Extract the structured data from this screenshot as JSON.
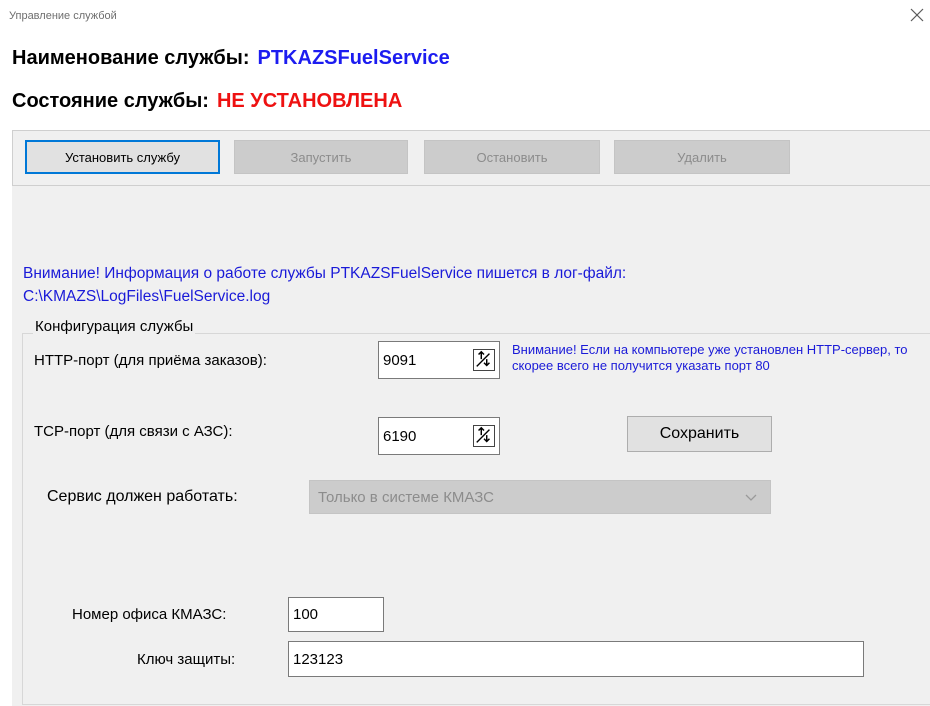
{
  "window": {
    "title": "Управление службой",
    "close_icon": "close-icon"
  },
  "header": {
    "name_label": "Наименование службы:",
    "name_value": "PTKAZSFuelService",
    "state_label": "Состояние службы:",
    "state_value": "НЕ УСТАНОВЛЕНА"
  },
  "toolbar": {
    "install": "Установить службу",
    "start": "Запустить",
    "stop": "Остановить",
    "delete": "Удалить"
  },
  "warning": {
    "line1": "Внимание! Информация о работе службы PTKAZSFuelService пишется в лог-файл:",
    "line2": "C:\\KMAZS\\LogFiles\\FuelService.log"
  },
  "config": {
    "group_title": "Конфигурация службы",
    "http_label": "HTTP-порт (для приёма заказов):",
    "http_value": "9091",
    "http_note": "Внимание! Если на компьютере уже установлен HTTP-сервер, то скорее всего не получится указать порт 80",
    "tcp_label": "TCP-порт (для связи с АЗС):",
    "tcp_value": "6190",
    "save": "Сохранить",
    "mode_label": "Сервис должен работать:",
    "mode_value": "Только в системе КМАЗС",
    "office_label": "Номер офиса КМАЗС:",
    "office_value": "100",
    "key_label": "Ключ защиты:",
    "key_value": "123123"
  },
  "colors": {
    "service_name": "#1c1cf0",
    "state_error": "#ee1111",
    "warning_text": "#1a1ad8",
    "focus_border": "#0078d7"
  }
}
